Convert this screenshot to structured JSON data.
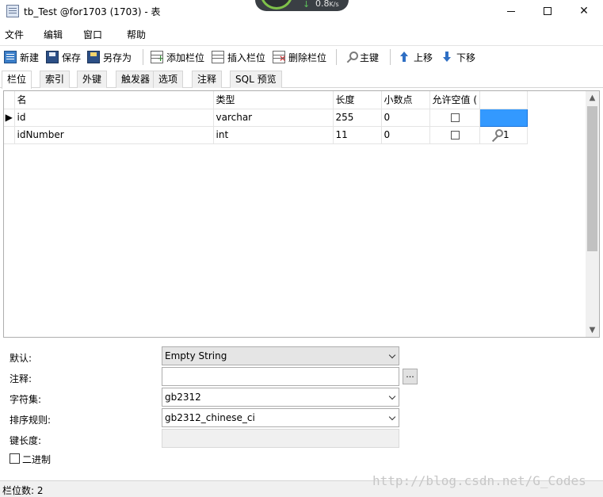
{
  "window": {
    "title": "tb_Test @for1703 (1703) - 表",
    "net_speed": "0.8",
    "net_unit": "K/s"
  },
  "menu": [
    "文件",
    "编辑",
    "窗口",
    "帮助"
  ],
  "toolbar": {
    "new": "新建",
    "save": "保存",
    "save_as": "另存为",
    "add_field": "添加栏位",
    "insert_field": "插入栏位",
    "delete_field": "删除栏位",
    "primary_key": "主键",
    "move_up": "上移",
    "move_down": "下移"
  },
  "tabs": [
    "栏位",
    "索引",
    "外键",
    "触发器",
    "选项",
    "注释",
    "SQL 预览"
  ],
  "grid": {
    "headers": [
      "名",
      "类型",
      "长度",
      "小数点",
      "允许空值 (",
      ""
    ],
    "rows": [
      {
        "name": "id",
        "type": "varchar",
        "length": "255",
        "decimals": "0",
        "allow_null": false,
        "key": ""
      },
      {
        "name": "idNumber",
        "type": "int",
        "length": "11",
        "decimals": "0",
        "allow_null": false,
        "key": "1"
      }
    ]
  },
  "properties": {
    "default_label": "默认:",
    "default_value": "Empty String",
    "comment_label": "注释:",
    "comment_value": "",
    "comment_button": "...",
    "charset_label": "字符集:",
    "charset_value": "gb2312",
    "collation_label": "排序规则:",
    "collation_value": "gb2312_chinese_ci",
    "key_length_label": "键长度:",
    "key_length_value": "",
    "binary_label": "二进制"
  },
  "status": {
    "field_count": "栏位数: 2"
  },
  "watermark": "http://blog.csdn.net/G_Codes"
}
